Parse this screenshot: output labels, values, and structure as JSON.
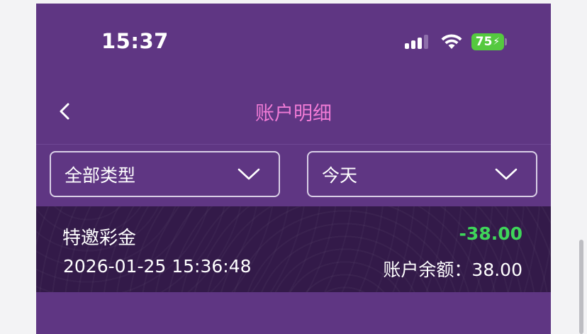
{
  "status_bar": {
    "time": "15:37",
    "battery": "75",
    "icons": [
      "signal-icon",
      "wifi-icon",
      "battery-icon",
      "bolt-icon"
    ]
  },
  "header": {
    "title": "账户明细",
    "back_icon": "chevron-left-icon"
  },
  "filters": {
    "type": {
      "selected": "全部类型",
      "icon": "chevron-down-icon"
    },
    "date": {
      "selected": "今天",
      "icon": "chevron-down-icon"
    }
  },
  "records": [
    {
      "title": "特邀彩金",
      "amount": "-38.00",
      "time": "2026-01-25 15:36:48",
      "balance": "账户余额：38.00"
    }
  ],
  "colors": {
    "background": "#5f3683",
    "record_background": "#331a49",
    "title": "#f07bd6",
    "amount": "#3fd65a",
    "battery": "#55c93f"
  }
}
